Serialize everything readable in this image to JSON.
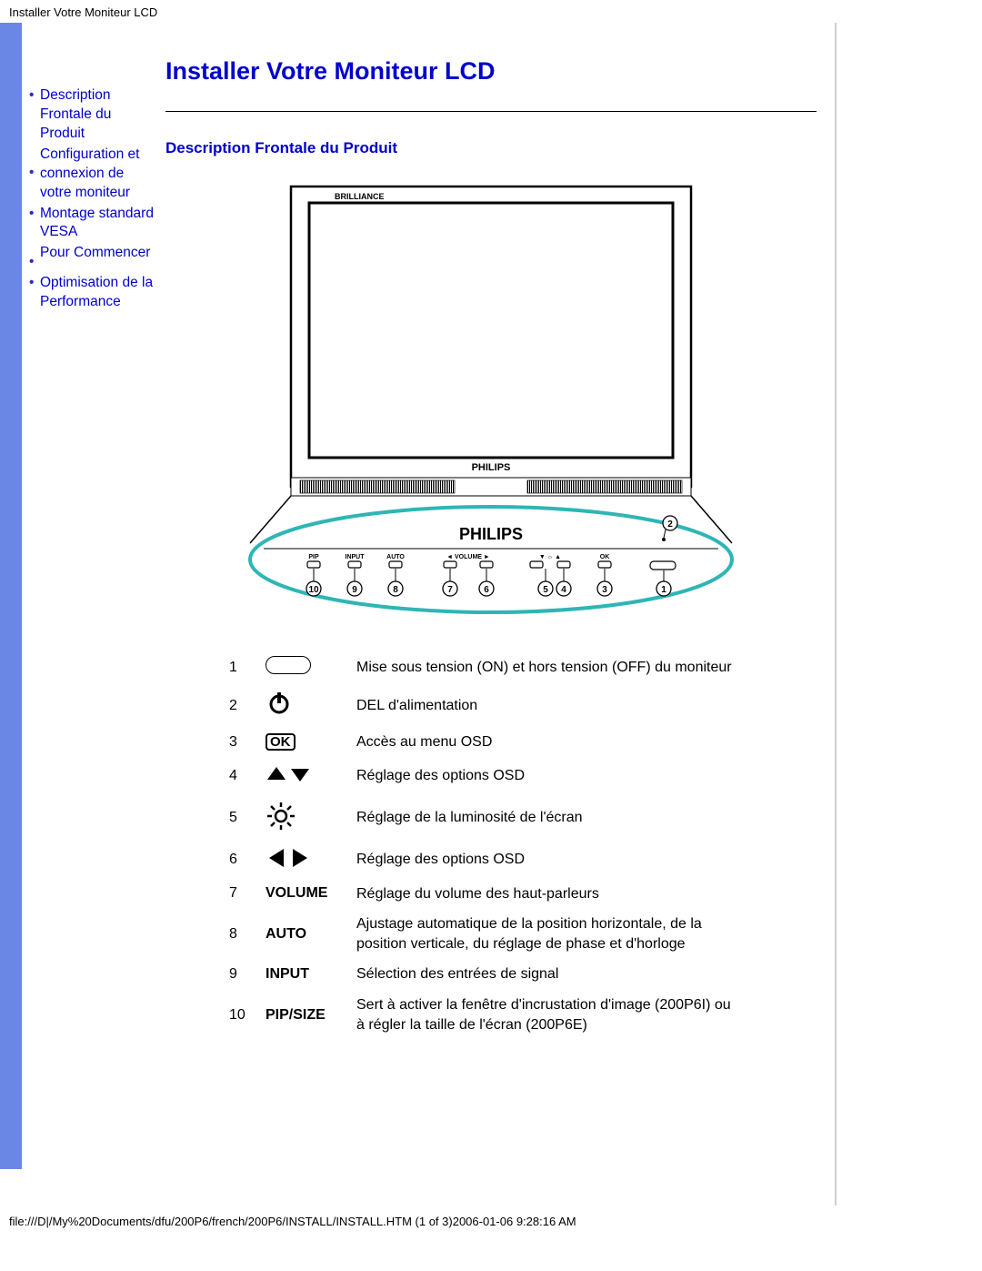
{
  "header": "Installer Votre Moniteur LCD",
  "nav": [
    "Description Frontale du Produit",
    "Configuration et connexion de votre moniteur",
    "Montage standard VESA",
    "Pour Commencer",
    "Optimisation de la Performance"
  ],
  "title": "Installer Votre Moniteur LCD",
  "section_heading": "Description Frontale du Produit",
  "brand": "PHILIPS",
  "panel_labels": [
    "PIP",
    "INPUT",
    "AUTO",
    "VOLUME",
    "OK"
  ],
  "controls": [
    {
      "n": "1",
      "icon": "power-button",
      "label": "",
      "desc": "Mise sous tension (ON) et hors tension (OFF) du moniteur"
    },
    {
      "n": "2",
      "icon": "power-symbol",
      "label": "",
      "desc": "DEL d'alimentation"
    },
    {
      "n": "3",
      "icon": "ok-box",
      "label": "OK",
      "desc": "Accès au menu OSD"
    },
    {
      "n": "4",
      "icon": "up-down",
      "label": "",
      "desc": "Réglage des options OSD"
    },
    {
      "n": "5",
      "icon": "brightness",
      "label": "",
      "desc": "Réglage de la luminosité de l'écran"
    },
    {
      "n": "6",
      "icon": "left-right",
      "label": "",
      "desc": "Réglage des options OSD"
    },
    {
      "n": "7",
      "icon": "text",
      "label": "VOLUME",
      "desc": "Réglage du volume des haut-parleurs"
    },
    {
      "n": "8",
      "icon": "text",
      "label": "AUTO",
      "desc": "Ajustage automatique de la position horizontale, de la position verticale, du réglage de phase et d'horloge"
    },
    {
      "n": "9",
      "icon": "text",
      "label": "INPUT",
      "desc": "Sélection des entrées de signal"
    },
    {
      "n": "10",
      "icon": "text",
      "label": "PIP/SIZE",
      "desc": "Sert à activer la fenêtre d'incrustation d'image (200P6I) ou\nà régler la taille de l'écran (200P6E)"
    }
  ],
  "footer": "file:///D|/My%20Documents/dfu/200P6/french/200P6/INSTALL/INSTALL.HTM (1 of 3)2006-01-06 9:28:16 AM"
}
